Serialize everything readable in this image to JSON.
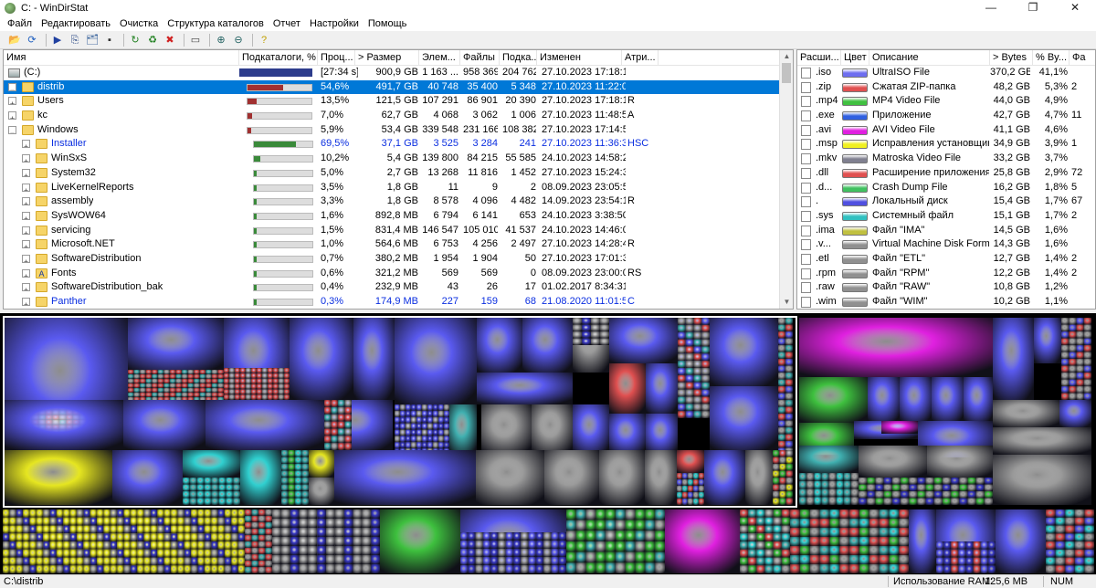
{
  "window": {
    "title": "C: - WinDirStat",
    "minimize": "—",
    "maximize": "❐",
    "close": "✕"
  },
  "menu": [
    "Файл",
    "Редактировать",
    "Очистка",
    "Структура каталогов",
    "Отчет",
    "Настройки",
    "Помощь"
  ],
  "toolbar": [
    {
      "icon": "open-folder-icon",
      "glyph": "📂"
    },
    {
      "icon": "refresh-icon",
      "glyph": "⟳"
    },
    {
      "icon": "open-item-icon",
      "glyph": "▶"
    },
    {
      "icon": "copy-path-icon",
      "glyph": "⎘"
    },
    {
      "icon": "explorer-icon",
      "glyph": "🗂"
    },
    {
      "icon": "command-prompt-icon",
      "glyph": "▪"
    },
    {
      "icon": "refresh-selected-icon",
      "glyph": "↻"
    },
    {
      "icon": "recycle-icon",
      "glyph": "♻"
    },
    {
      "icon": "delete-icon",
      "glyph": "✖"
    },
    {
      "icon": "new-folder-icon",
      "glyph": "▭"
    },
    {
      "icon": "zoom-in-icon",
      "glyph": "⊕"
    },
    {
      "icon": "zoom-out-icon",
      "glyph": "⊖"
    },
    {
      "icon": "help-icon",
      "glyph": "?"
    }
  ],
  "colors": {
    "selection": "#0078d7",
    "highlight_text": "#0a2ee0",
    "root_bar": "#2d3c8c"
  },
  "tree": {
    "columns": [
      "Имя",
      "Подкаталоги, %",
      "Проц...",
      "> Размер",
      "Элем...",
      "Файлы",
      "Подка...",
      "Изменен",
      "Атри..."
    ],
    "rows": [
      {
        "name": "(C:)",
        "level": 0,
        "type": "drive",
        "expander": "",
        "percent_text": "[27:34 s]",
        "subdir_fraction": 1.0,
        "size": "900,9 GB",
        "items": "1 163 ...",
        "files": "958 369",
        "subdirs": "204 762",
        "modified": "27.10.2023  17:18:11",
        "attr": ""
      },
      {
        "name": "distrib",
        "level": 1,
        "type": "folder",
        "expander": "−",
        "percent_text": "54,6%",
        "subdir_fraction": 0.546,
        "bar_color": "#a03030",
        "size": "491,7 GB",
        "items": "40 748",
        "files": "35 400",
        "subdirs": "5 348",
        "modified": "27.10.2023  11:22:05",
        "attr": "",
        "selected": true
      },
      {
        "name": "Users",
        "level": 1,
        "type": "folder",
        "expander": "+",
        "percent_text": "13,5%",
        "subdir_fraction": 0.135,
        "bar_color": "#a03030",
        "size": "121,5 GB",
        "items": "107 291",
        "files": "86 901",
        "subdirs": "20 390",
        "modified": "27.10.2023  17:18:11",
        "attr": "R"
      },
      {
        "name": "kc",
        "level": 1,
        "type": "folder",
        "expander": "+",
        "percent_text": "7,0%",
        "subdir_fraction": 0.07,
        "bar_color": "#a03030",
        "size": "62,7 GB",
        "items": "4 068",
        "files": "3 062",
        "subdirs": "1 006",
        "modified": "27.10.2023  11:48:54",
        "attr": "A"
      },
      {
        "name": "Windows",
        "level": 1,
        "type": "folder",
        "expander": "−",
        "percent_text": "5,9%",
        "subdir_fraction": 0.059,
        "bar_color": "#a03030",
        "size": "53,4 GB",
        "items": "339 548",
        "files": "231 166",
        "subdirs": "108 382",
        "modified": "27.10.2023  17:14:50",
        "attr": ""
      },
      {
        "name": "Installer",
        "level": 2,
        "type": "folder",
        "expander": "+",
        "percent_text": "69,5%",
        "subdir_fraction": 0.695,
        "bar_color": "#3a8a3a",
        "size": "37,1 GB",
        "items": "3 525",
        "files": "3 284",
        "subdirs": "241",
        "modified": "27.10.2023  11:36:37",
        "attr": "HSC",
        "blue": true
      },
      {
        "name": "WinSxS",
        "level": 2,
        "type": "folder",
        "expander": "+",
        "percent_text": "10,2%",
        "subdir_fraction": 0.102,
        "bar_color": "#3a8a3a",
        "size": "5,4 GB",
        "items": "139 800",
        "files": "84 215",
        "subdirs": "55 585",
        "modified": "24.10.2023  14:58:24",
        "attr": ""
      },
      {
        "name": "System32",
        "level": 2,
        "type": "folder",
        "expander": "+",
        "percent_text": "5,0%",
        "subdir_fraction": 0.05,
        "bar_color": "#3a8a3a",
        "size": "2,7 GB",
        "items": "13 268",
        "files": "11 816",
        "subdirs": "1 452",
        "modified": "27.10.2023  15:24:39",
        "attr": ""
      },
      {
        "name": "LiveKernelReports",
        "level": 2,
        "type": "folder",
        "expander": "+",
        "percent_text": "3,5%",
        "subdir_fraction": 0.035,
        "bar_color": "#3a8a3a",
        "size": "1,8 GB",
        "items": "11",
        "files": "9",
        "subdirs": "2",
        "modified": "08.09.2023  23:05:52",
        "attr": ""
      },
      {
        "name": "assembly",
        "level": 2,
        "type": "folder",
        "expander": "+",
        "percent_text": "3,3%",
        "subdir_fraction": 0.033,
        "bar_color": "#3a8a3a",
        "size": "1,8 GB",
        "items": "8 578",
        "files": "4 096",
        "subdirs": "4 482",
        "modified": "14.09.2023  23:54:14",
        "attr": "R"
      },
      {
        "name": "SysWOW64",
        "level": 2,
        "type": "folder",
        "expander": "+",
        "percent_text": "1,6%",
        "subdir_fraction": 0.016,
        "bar_color": "#3a8a3a",
        "size": "892,8 MB",
        "items": "6 794",
        "files": "6 141",
        "subdirs": "653",
        "modified": "24.10.2023  3:38:50",
        "attr": ""
      },
      {
        "name": "servicing",
        "level": 2,
        "type": "folder",
        "expander": "+",
        "percent_text": "1,5%",
        "subdir_fraction": 0.015,
        "bar_color": "#3a8a3a",
        "size": "831,4 MB",
        "items": "146 547",
        "files": "105 010",
        "subdirs": "41 537",
        "modified": "24.10.2023  14:46:02",
        "attr": ""
      },
      {
        "name": "Microsoft.NET",
        "level": 2,
        "type": "folder",
        "expander": "+",
        "percent_text": "1,0%",
        "subdir_fraction": 0.01,
        "bar_color": "#3a8a3a",
        "size": "564,6 MB",
        "items": "6 753",
        "files": "4 256",
        "subdirs": "2 497",
        "modified": "27.10.2023  14:28:48",
        "attr": "R"
      },
      {
        "name": "SoftwareDistribution",
        "level": 2,
        "type": "folder",
        "expander": "+",
        "percent_text": "0,7%",
        "subdir_fraction": 0.007,
        "bar_color": "#3a8a3a",
        "size": "380,2 MB",
        "items": "1 954",
        "files": "1 904",
        "subdirs": "50",
        "modified": "27.10.2023  17:01:33",
        "attr": ""
      },
      {
        "name": "Fonts",
        "level": 2,
        "type": "fonts",
        "expander": "+",
        "percent_text": "0,6%",
        "subdir_fraction": 0.006,
        "bar_color": "#3a8a3a",
        "size": "321,2 MB",
        "items": "569",
        "files": "569",
        "subdirs": "0",
        "modified": "08.09.2023  23:00:02",
        "attr": "RS"
      },
      {
        "name": "SoftwareDistribution_bak",
        "level": 2,
        "type": "folder",
        "expander": "+",
        "percent_text": "0,4%",
        "subdir_fraction": 0.004,
        "bar_color": "#3a8a3a",
        "size": "232,9 MB",
        "items": "43",
        "files": "26",
        "subdirs": "17",
        "modified": "01.02.2017  8:34:31",
        "attr": ""
      },
      {
        "name": "Panther",
        "level": 2,
        "type": "folder",
        "expander": "+",
        "percent_text": "0,3%",
        "subdir_fraction": 0.003,
        "bar_color": "#3a8a3a",
        "size": "174,9 MB",
        "items": "227",
        "files": "159",
        "subdirs": "68",
        "modified": "21.08.2020  11:01:55",
        "attr": "C",
        "blue": true
      }
    ]
  },
  "extensions": {
    "columns": [
      "Расши...",
      "Цвет",
      "Описание",
      "> Bytes",
      "% By...",
      "Фа"
    ],
    "rows": [
      {
        "ext": ".iso",
        "color": "#6e6ef0",
        "desc": "UltraISO File",
        "bytes": "370,2 GB",
        "pct": "41,1%",
        "files": ""
      },
      {
        "ext": ".zip",
        "color": "#e05050",
        "desc": "Сжатая ZIP-папка",
        "bytes": "48,2 GB",
        "pct": "5,3%",
        "files": "2"
      },
      {
        "ext": ".mp4",
        "color": "#40c040",
        "desc": "MP4 Video File",
        "bytes": "44,0 GB",
        "pct": "4,9%",
        "files": ""
      },
      {
        "ext": ".exe",
        "color": "#3060e0",
        "desc": "Приложение",
        "bytes": "42,7 GB",
        "pct": "4,7%",
        "files": "11"
      },
      {
        "ext": ".avi",
        "color": "#e020e0",
        "desc": "AVI Video File",
        "bytes": "41,1 GB",
        "pct": "4,6%",
        "files": ""
      },
      {
        "ext": ".msp",
        "color": "#f0f020",
        "desc": "Исправления установщик...",
        "bytes": "34,9 GB",
        "pct": "3,9%",
        "files": "1"
      },
      {
        "ext": ".mkv",
        "color": "#808090",
        "desc": "Matroska Video File",
        "bytes": "33,2 GB",
        "pct": "3,7%",
        "files": ""
      },
      {
        "ext": ".dll",
        "color": "#e05050",
        "desc": "Расширение приложения",
        "bytes": "25,8 GB",
        "pct": "2,9%",
        "files": "72"
      },
      {
        "ext": ".d...",
        "color": "#40c060",
        "desc": "Crash Dump File",
        "bytes": "16,2 GB",
        "pct": "1,8%",
        "files": "5"
      },
      {
        "ext": ".",
        "color": "#5050e0",
        "desc": "Локальный диск",
        "bytes": "15,4 GB",
        "pct": "1,7%",
        "files": "67"
      },
      {
        "ext": ".sys",
        "color": "#30c0c0",
        "desc": "Системный файл",
        "bytes": "15,1 GB",
        "pct": "1,7%",
        "files": "2"
      },
      {
        "ext": ".ima",
        "color": "#c0c040",
        "desc": "Файл \"IMA\"",
        "bytes": "14,5 GB",
        "pct": "1,6%",
        "files": ""
      },
      {
        "ext": ".v...",
        "color": "#909090",
        "desc": "Virtual Machine Disk Format",
        "bytes": "14,3 GB",
        "pct": "1,6%",
        "files": ""
      },
      {
        "ext": ".etl",
        "color": "#909090",
        "desc": "Файл \"ETL\"",
        "bytes": "12,7 GB",
        "pct": "1,4%",
        "files": "2"
      },
      {
        "ext": ".rpm",
        "color": "#909090",
        "desc": "Файл \"RPM\"",
        "bytes": "12,2 GB",
        "pct": "1,4%",
        "files": "2"
      },
      {
        "ext": ".raw",
        "color": "#909090",
        "desc": "Файл \"RAW\"",
        "bytes": "10,8 GB",
        "pct": "1,2%",
        "files": ""
      },
      {
        "ext": ".wim",
        "color": "#909090",
        "desc": "Файл \"WIM\"",
        "bytes": "10,2 GB",
        "pct": "1,1%",
        "files": ""
      }
    ]
  },
  "status": {
    "path": "C:\\distrib",
    "ram_label": "Использование RAM:",
    "ram_value": "125,6 MB",
    "num": "NUM"
  }
}
